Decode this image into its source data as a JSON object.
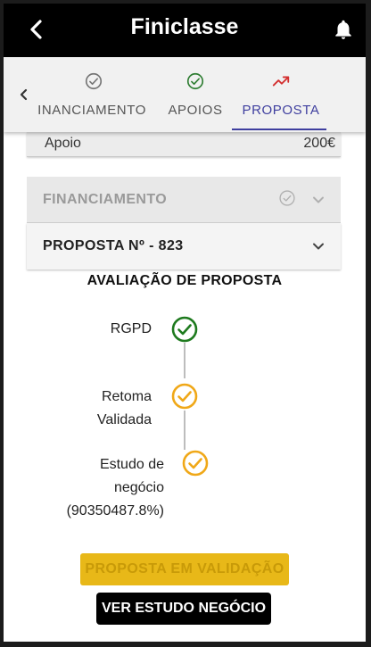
{
  "header": {
    "title": "Finiclasse"
  },
  "tabs": [
    {
      "label": "INANCIAMENTO",
      "icon": "check-circle-icon",
      "color": "#757575"
    },
    {
      "label": "APOIOS",
      "icon": "check-circle-icon",
      "color": "#2e7d32"
    },
    {
      "label": "PROPOSTA",
      "icon": "trending-up-icon",
      "color": "#d32f2f",
      "active": true
    }
  ],
  "apoio": {
    "label": "Apoio",
    "value": "200€"
  },
  "accordions": {
    "financiamento": {
      "title": "FINANCIAMENTO"
    },
    "proposta": {
      "title": "PROPOSTA Nº - 823"
    }
  },
  "evaluation": {
    "title": "AVALIAÇÃO DE PROPOSTA",
    "steps": [
      {
        "lines": [
          "RGPD"
        ],
        "status": "approved",
        "color": "#1e7a1e"
      },
      {
        "lines": [
          "Retoma",
          "Validada"
        ],
        "status": "pending",
        "color": "#f0a818"
      },
      {
        "lines": [
          "Estudo de",
          "negócio",
          "(90350487.8%)"
        ],
        "status": "pending",
        "color": "#f0a818"
      }
    ]
  },
  "buttons": {
    "validation": "PROPOSTA EM VALIDAÇÃO",
    "estudo": "VER ESTUDO NEGÓCIO"
  }
}
